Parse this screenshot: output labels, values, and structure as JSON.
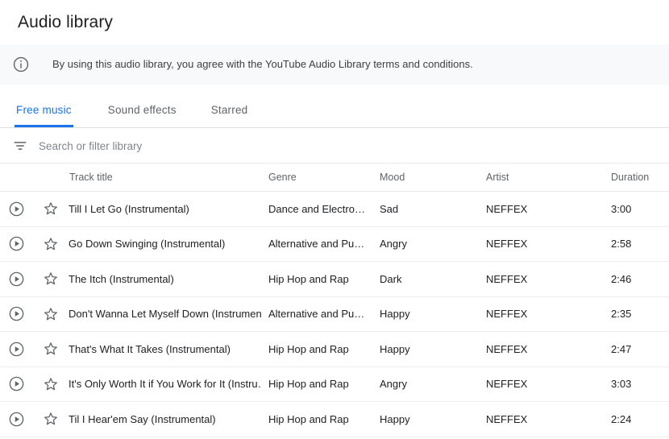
{
  "page": {
    "title": "Audio library"
  },
  "banner": {
    "icon": "info-icon",
    "text": "By using this audio library, you agree with the YouTube Audio Library terms and conditions."
  },
  "tabs": [
    {
      "label": "Free music",
      "active": true
    },
    {
      "label": "Sound effects",
      "active": false
    },
    {
      "label": "Starred",
      "active": false
    }
  ],
  "search": {
    "icon": "filter-list-icon",
    "value": "",
    "placeholder": "Search or filter library"
  },
  "table": {
    "columns": {
      "track_title": "Track title",
      "genre": "Genre",
      "mood": "Mood",
      "artist": "Artist",
      "duration": "Duration"
    },
    "rows": [
      {
        "play_icon": "play-circle-icon",
        "star_icon": "star-outline-icon",
        "title": "Till I Let Go (Instrumental)",
        "genre": "Dance and Electro…",
        "mood": "Sad",
        "artist": "NEFFEX",
        "duration": "3:00"
      },
      {
        "play_icon": "play-circle-icon",
        "star_icon": "star-outline-icon",
        "title": "Go Down Swinging (Instrumental)",
        "genre": "Alternative and Pu…",
        "mood": "Angry",
        "artist": "NEFFEX",
        "duration": "2:58"
      },
      {
        "play_icon": "play-circle-icon",
        "star_icon": "star-outline-icon",
        "title": "The Itch (Instrumental)",
        "genre": "Hip Hop and Rap",
        "mood": "Dark",
        "artist": "NEFFEX",
        "duration": "2:46"
      },
      {
        "play_icon": "play-circle-icon",
        "star_icon": "star-outline-icon",
        "title": "Don't Wanna Let Myself Down (Instrument…",
        "genre": "Alternative and Pu…",
        "mood": "Happy",
        "artist": "NEFFEX",
        "duration": "2:35"
      },
      {
        "play_icon": "play-circle-icon",
        "star_icon": "star-outline-icon",
        "title": "That's What It Takes (Instrumental)",
        "genre": "Hip Hop and Rap",
        "mood": "Happy",
        "artist": "NEFFEX",
        "duration": "2:47"
      },
      {
        "play_icon": "play-circle-icon",
        "star_icon": "star-outline-icon",
        "title": "It's Only Worth It if You Work for It (Instru…",
        "genre": "Hip Hop and Rap",
        "mood": "Angry",
        "artist": "NEFFEX",
        "duration": "3:03"
      },
      {
        "play_icon": "play-circle-icon",
        "star_icon": "star-outline-icon",
        "title": "Til I Hear'em Say (Instrumental)",
        "genre": "Hip Hop and Rap",
        "mood": "Happy",
        "artist": "NEFFEX",
        "duration": "2:24"
      }
    ]
  },
  "colors": {
    "accent": "#1a73e8",
    "text_primary": "#202124",
    "text_secondary": "#5f6368",
    "banner_bg": "#f8f9fa",
    "divider": "#e8e8e8"
  }
}
